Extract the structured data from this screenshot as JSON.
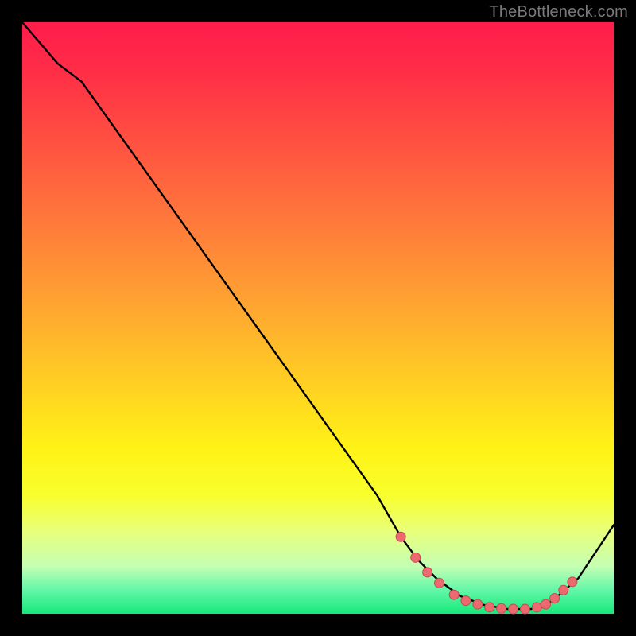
{
  "watermark": {
    "text": "TheBottleneck.com"
  },
  "colors": {
    "page_bg": "#000000",
    "curve": "#000000",
    "marker_fill": "#ec6a6f",
    "marker_stroke": "#c44a50"
  },
  "chart_data": {
    "type": "line",
    "title": "",
    "xlabel": "",
    "ylabel": "",
    "xlim": [
      0,
      100
    ],
    "ylim": [
      0,
      100
    ],
    "grid": false,
    "legend": false,
    "series": [
      {
        "name": "curve",
        "x": [
          0,
          6,
          10,
          20,
          30,
          40,
          50,
          60,
          64,
          67,
          70,
          74,
          78,
          82,
          86,
          88,
          90,
          94,
          100
        ],
        "y": [
          100,
          93,
          90,
          76,
          62,
          48,
          34,
          20,
          13,
          9,
          6,
          3,
          1.5,
          0.8,
          0.8,
          1.2,
          2.5,
          6,
          15
        ]
      }
    ],
    "markers": [
      {
        "x": 64.0,
        "y": 13.0
      },
      {
        "x": 66.5,
        "y": 9.5
      },
      {
        "x": 68.5,
        "y": 7.0
      },
      {
        "x": 70.5,
        "y": 5.2
      },
      {
        "x": 73.0,
        "y": 3.2
      },
      {
        "x": 75.0,
        "y": 2.2
      },
      {
        "x": 77.0,
        "y": 1.6
      },
      {
        "x": 79.0,
        "y": 1.1
      },
      {
        "x": 81.0,
        "y": 0.9
      },
      {
        "x": 83.0,
        "y": 0.8
      },
      {
        "x": 85.0,
        "y": 0.8
      },
      {
        "x": 87.0,
        "y": 1.1
      },
      {
        "x": 88.5,
        "y": 1.6
      },
      {
        "x": 90.0,
        "y": 2.6
      },
      {
        "x": 91.5,
        "y": 4.0
      },
      {
        "x": 93.0,
        "y": 5.4
      }
    ]
  }
}
